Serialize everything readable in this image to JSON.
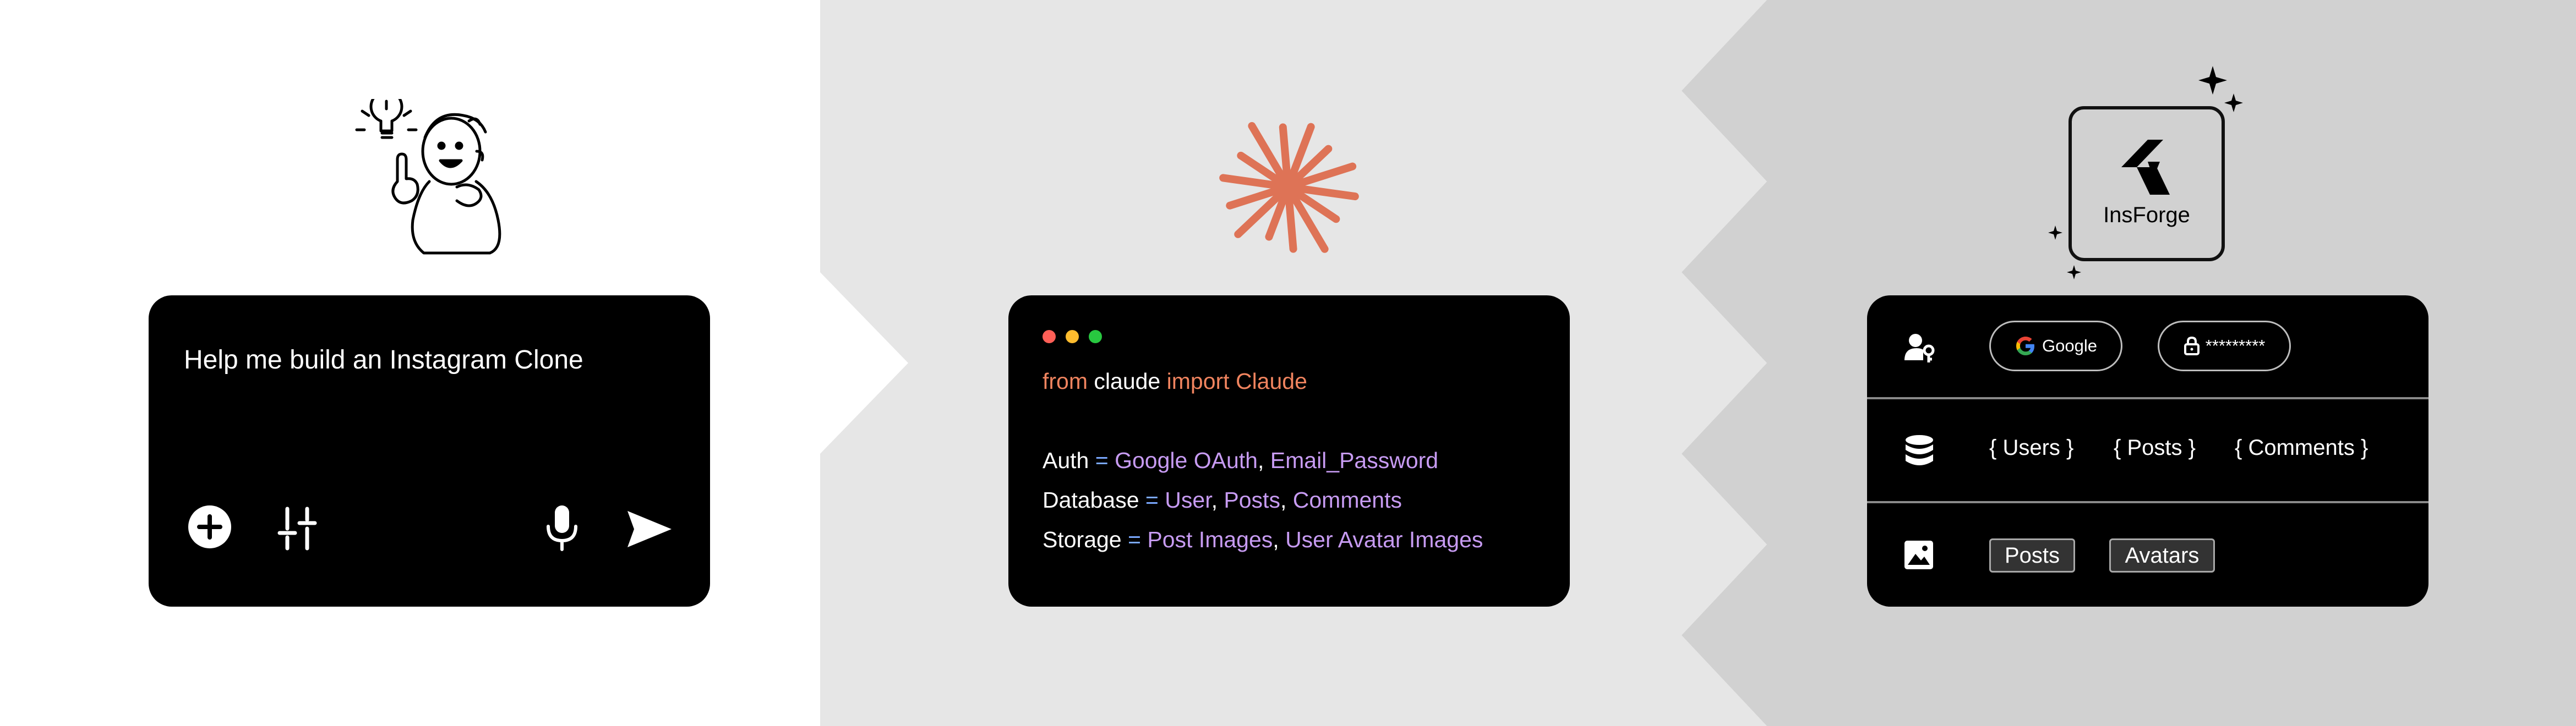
{
  "colors": {
    "panel_left": "#ffffff",
    "panel_middle": "#e6e6e6",
    "panel_right": "#d1d1d1",
    "card_bg": "#000000",
    "claude_orange": "#de7356",
    "keyword": "#f0845f",
    "operator": "#7aa8ff",
    "value": "#c79bf2"
  },
  "prompt_card": {
    "text": "Help me build an Instagram Clone",
    "icons": [
      "plus-circle-icon",
      "sliders-icon",
      "microphone-icon",
      "send-icon"
    ]
  },
  "code_card": {
    "line1": {
      "from": "from",
      "module": "claude",
      "import": "import",
      "name": "Claude"
    },
    "auth": {
      "key": "Auth",
      "eq": "=",
      "v1": "Google OAuth",
      "v2": "Email_Password"
    },
    "database": {
      "key": "Database",
      "eq": "=",
      "v1": "User",
      "v2": "Posts",
      "v3": "Comments"
    },
    "storage": {
      "key": "Storage",
      "eq": "=",
      "v1": "Post Images",
      "v2": "User Avatar Images"
    },
    "comma": ","
  },
  "insforge": {
    "logo_label": "InsForge",
    "auth_row": {
      "google_label": "Google",
      "password_label": "*********"
    },
    "database_row": {
      "tables": [
        "{ Users }",
        "{ Posts }",
        "{ Comments }"
      ]
    },
    "storage_row": {
      "buckets": [
        "Posts",
        "Avatars"
      ]
    }
  }
}
